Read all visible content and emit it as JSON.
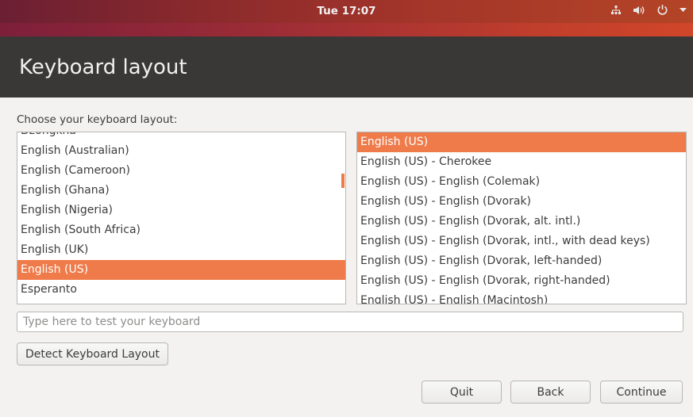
{
  "topbar": {
    "clock": "Tue 17:07"
  },
  "window": {
    "title": "Keyboard layout",
    "prompt": "Choose your keyboard layout:"
  },
  "layouts": {
    "partial_top": "Dzongkha",
    "items": [
      "English (Australian)",
      "English (Cameroon)",
      "English (Ghana)",
      "English (Nigeria)",
      "English (South Africa)",
      "English (UK)",
      "English (US)",
      "Esperanto"
    ],
    "selected": "English (US)"
  },
  "variants": {
    "items": [
      "English (US)",
      "English (US) - Cherokee",
      "English (US) - English (Colemak)",
      "English (US) - English (Dvorak)",
      "English (US) - English (Dvorak, alt. intl.)",
      "English (US) - English (Dvorak, intl., with dead keys)",
      "English (US) - English (Dvorak, left-handed)",
      "English (US) - English (Dvorak, right-handed)",
      "English (US) - English (Macintosh)"
    ],
    "selected": "English (US)"
  },
  "test_input": {
    "placeholder": "Type here to test your keyboard",
    "value": ""
  },
  "buttons": {
    "detect": "Detect Keyboard Layout",
    "quit": "Quit",
    "back": "Back",
    "continue": "Continue"
  },
  "colors": {
    "accent": "#ef7b4a",
    "headerbar": "#393837",
    "background": "#f3f2f1"
  },
  "icons": [
    "network-icon",
    "volume-icon",
    "power-icon",
    "chevron-down-icon"
  ]
}
